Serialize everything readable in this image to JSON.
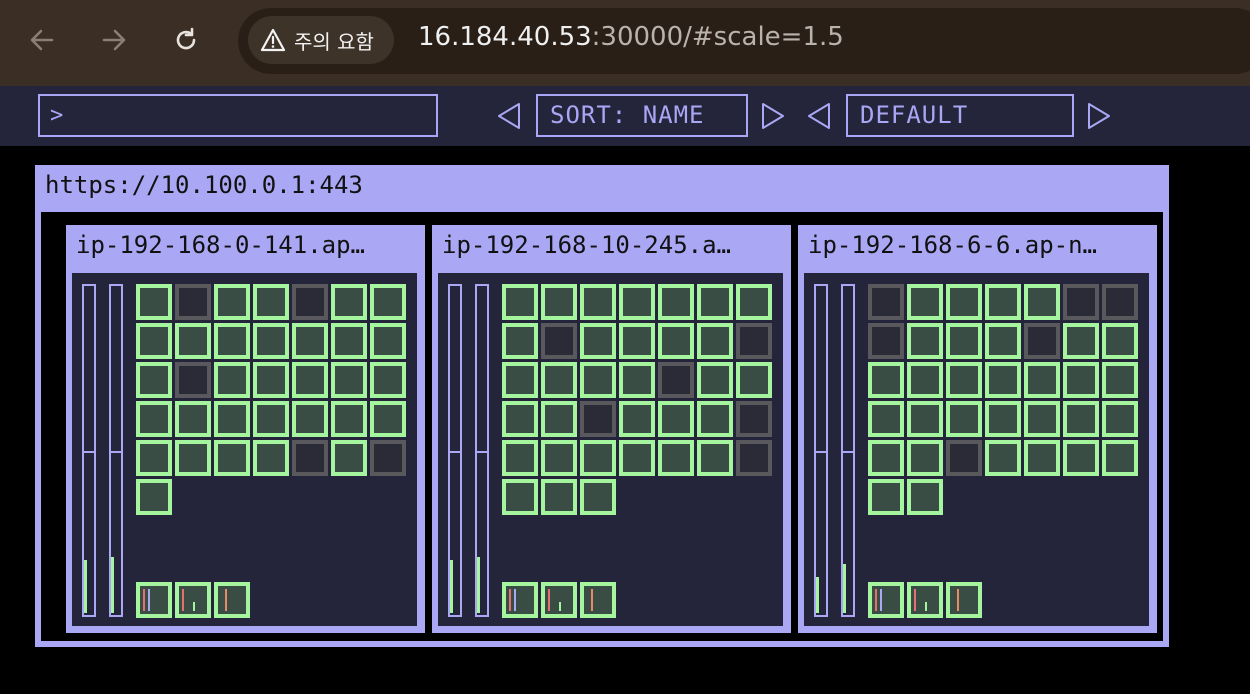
{
  "browser": {
    "warning_label": "주의 요함",
    "url_host": "16.184.40.53",
    "url_rest": ":30000/#scale=1.5"
  },
  "toolbar": {
    "filter_prompt": ">",
    "sort_label": "SORT: NAME",
    "group_label": "DEFAULT"
  },
  "cluster": {
    "title": "https://10.100.0.1:443"
  },
  "nodes": [
    {
      "title": "ip-192-168-0-141.ap…",
      "cpu_level": 0.16,
      "mem_level": 0.17,
      "pod_status": [
        "ok",
        "pending",
        "ok",
        "ok",
        "pending",
        "ok",
        "ok",
        "ok",
        "ok",
        "ok",
        "ok",
        "ok",
        "ok",
        "ok",
        "ok",
        "pending",
        "ok",
        "ok",
        "ok",
        "ok",
        "ok",
        "ok",
        "ok",
        "ok",
        "ok",
        "ok",
        "ok",
        "ok",
        "ok",
        "ok",
        "ok",
        "ok",
        "pending",
        "ok",
        "pending",
        "ok"
      ],
      "system_pods": 3
    },
    {
      "title": "ip-192-168-10-245.a…",
      "cpu_level": 0.16,
      "mem_level": 0.17,
      "pod_status": [
        "ok",
        "ok",
        "ok",
        "ok",
        "ok",
        "ok",
        "ok",
        "ok",
        "pending",
        "ok",
        "ok",
        "ok",
        "ok",
        "pending",
        "ok",
        "ok",
        "ok",
        "ok",
        "pending",
        "ok",
        "ok",
        "ok",
        "ok",
        "pending",
        "ok",
        "ok",
        "ok",
        "pending",
        "ok",
        "ok",
        "ok",
        "ok",
        "ok",
        "ok",
        "pending",
        "ok",
        "ok",
        "ok"
      ],
      "system_pods": 3
    },
    {
      "title": "ip-192-168-6-6.ap-n…",
      "cpu_level": 0.11,
      "mem_level": 0.15,
      "pod_status": [
        "pending",
        "ok",
        "ok",
        "ok",
        "ok",
        "pending",
        "pending",
        "pending",
        "ok",
        "ok",
        "ok",
        "pending",
        "ok",
        "ok",
        "ok",
        "ok",
        "ok",
        "ok",
        "ok",
        "ok",
        "ok",
        "ok",
        "ok",
        "ok",
        "ok",
        "ok",
        "ok",
        "ok",
        "ok",
        "ok",
        "pending",
        "ok",
        "ok",
        "ok",
        "ok",
        "ok",
        "ok"
      ],
      "system_pods": 3
    }
  ],
  "colors": {
    "accent": "#aaa7f5",
    "ok": "#a5f59e",
    "pending": "#58585d",
    "panel": "#24253a"
  }
}
